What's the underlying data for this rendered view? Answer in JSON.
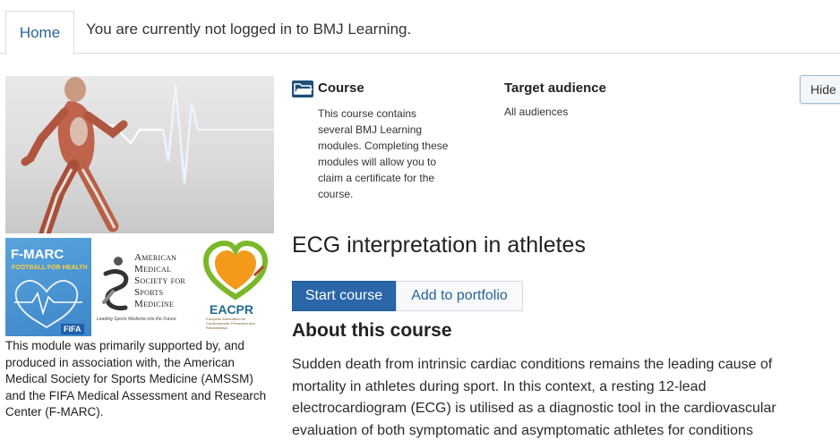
{
  "nav": {
    "home_label": "Home",
    "login_message": "You are currently not logged in to BMJ Learning."
  },
  "sponsors": {
    "fmarc_title": "F-MARC",
    "fmarc_subtitle": "FOOTBALL FOR HEALTH",
    "fmarc_org": "FIFA",
    "amssm_name": "American Medical Society for Sports Medicine",
    "amssm_tagline": "Leading Sports Medicine into the Future",
    "eacpr_name": "EACPR",
    "eacpr_full": "European Association for Cardiovascular Prevention and Rehabilitation",
    "support_text": "This module was primarily supported by, and produced in association with, the American Medical Society for Sports Medicine (AMSSM) and the FIFA Medical Assessment and Research Center (F-MARC)."
  },
  "course_info": {
    "type_label": "Course",
    "type_description": "This course contains several BMJ Learning modules. Completing these modules will allow you to claim a certificate for the course.",
    "audience_label": "Target audience",
    "audience_value": "All audiences",
    "hide_label": "Hide"
  },
  "main": {
    "title": "ECG interpretation in athletes",
    "start_label": "Start course",
    "portfolio_label": "Add to portfolio",
    "about_heading": "About this course",
    "about_text": "Sudden death from intrinsic cardiac conditions remains the leading cause of mortality in athletes during sport. In this context, a resting 12-lead electrocardiogram (ECG) is utilised as a diagnostic tool in the cardiovascular evaluation of both symptomatic and asymptomatic athletes for conditions"
  },
  "colors": {
    "primary": "#2a66a8",
    "link": "#2a6496",
    "fmarc_blue": "#3d86c9",
    "eacpr_green": "#7ab829",
    "eacpr_orange": "#f39a1b"
  },
  "icons": {
    "course_icon": "folder-open-icon"
  }
}
